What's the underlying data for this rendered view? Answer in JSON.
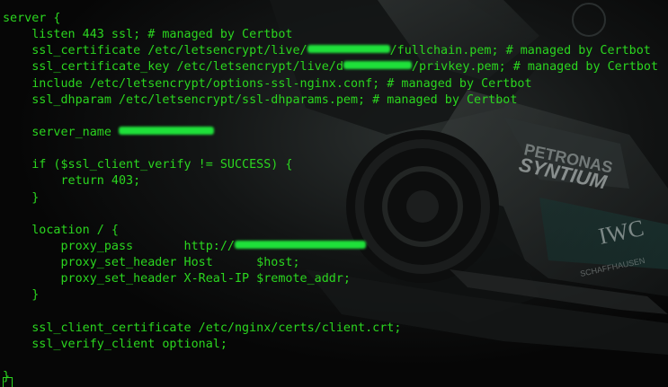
{
  "terminal": {
    "theme": {
      "text_color": "#2bd61f",
      "background": "#080808",
      "redaction_color": "#1fe03a"
    },
    "wallpaper": {
      "sponsor_1": "PETRONAS",
      "sponsor_2": "SYNTIUM",
      "sponsor_3": "IWC",
      "sponsor_3_sub": "SCHAFFHAUSEN"
    },
    "lines": [
      {
        "text": "server {"
      },
      {
        "text": "    listen 443 ssl; # managed by Certbot"
      },
      {
        "pre": "    ssl_certificate /etc/letsencrypt/live/",
        "redacted": true,
        "post": "/fullchain.pem; # managed by Certbot"
      },
      {
        "pre": "    ssl_certificate_key /etc/letsencrypt/live/d",
        "redacted": true,
        "post": "/privkey.pem; # managed by Certbot"
      },
      {
        "text": "    include /etc/letsencrypt/options-ssl-nginx.conf; # managed by Certbot"
      },
      {
        "text": "    ssl_dhparam /etc/letsencrypt/ssl-dhparams.pem; # managed by Certbot"
      },
      {
        "text": ""
      },
      {
        "pre": "    server_name ",
        "redacted": true,
        "post": ""
      },
      {
        "text": ""
      },
      {
        "text": "    if ($ssl_client_verify != SUCCESS) {"
      },
      {
        "text": "        return 403;"
      },
      {
        "text": "    }"
      },
      {
        "text": ""
      },
      {
        "text": "    location / {"
      },
      {
        "pre": "        proxy_pass       http://",
        "redacted": true,
        "post": ""
      },
      {
        "text": "        proxy_set_header Host      $host;"
      },
      {
        "text": "        proxy_set_header X-Real-IP $remote_addr;"
      },
      {
        "text": "    }"
      },
      {
        "text": ""
      },
      {
        "text": "    ssl_client_certificate /etc/nginx/certs/client.crt;"
      },
      {
        "text": "    ssl_verify_client optional;"
      },
      {
        "text": ""
      },
      {
        "text": "}"
      }
    ]
  }
}
